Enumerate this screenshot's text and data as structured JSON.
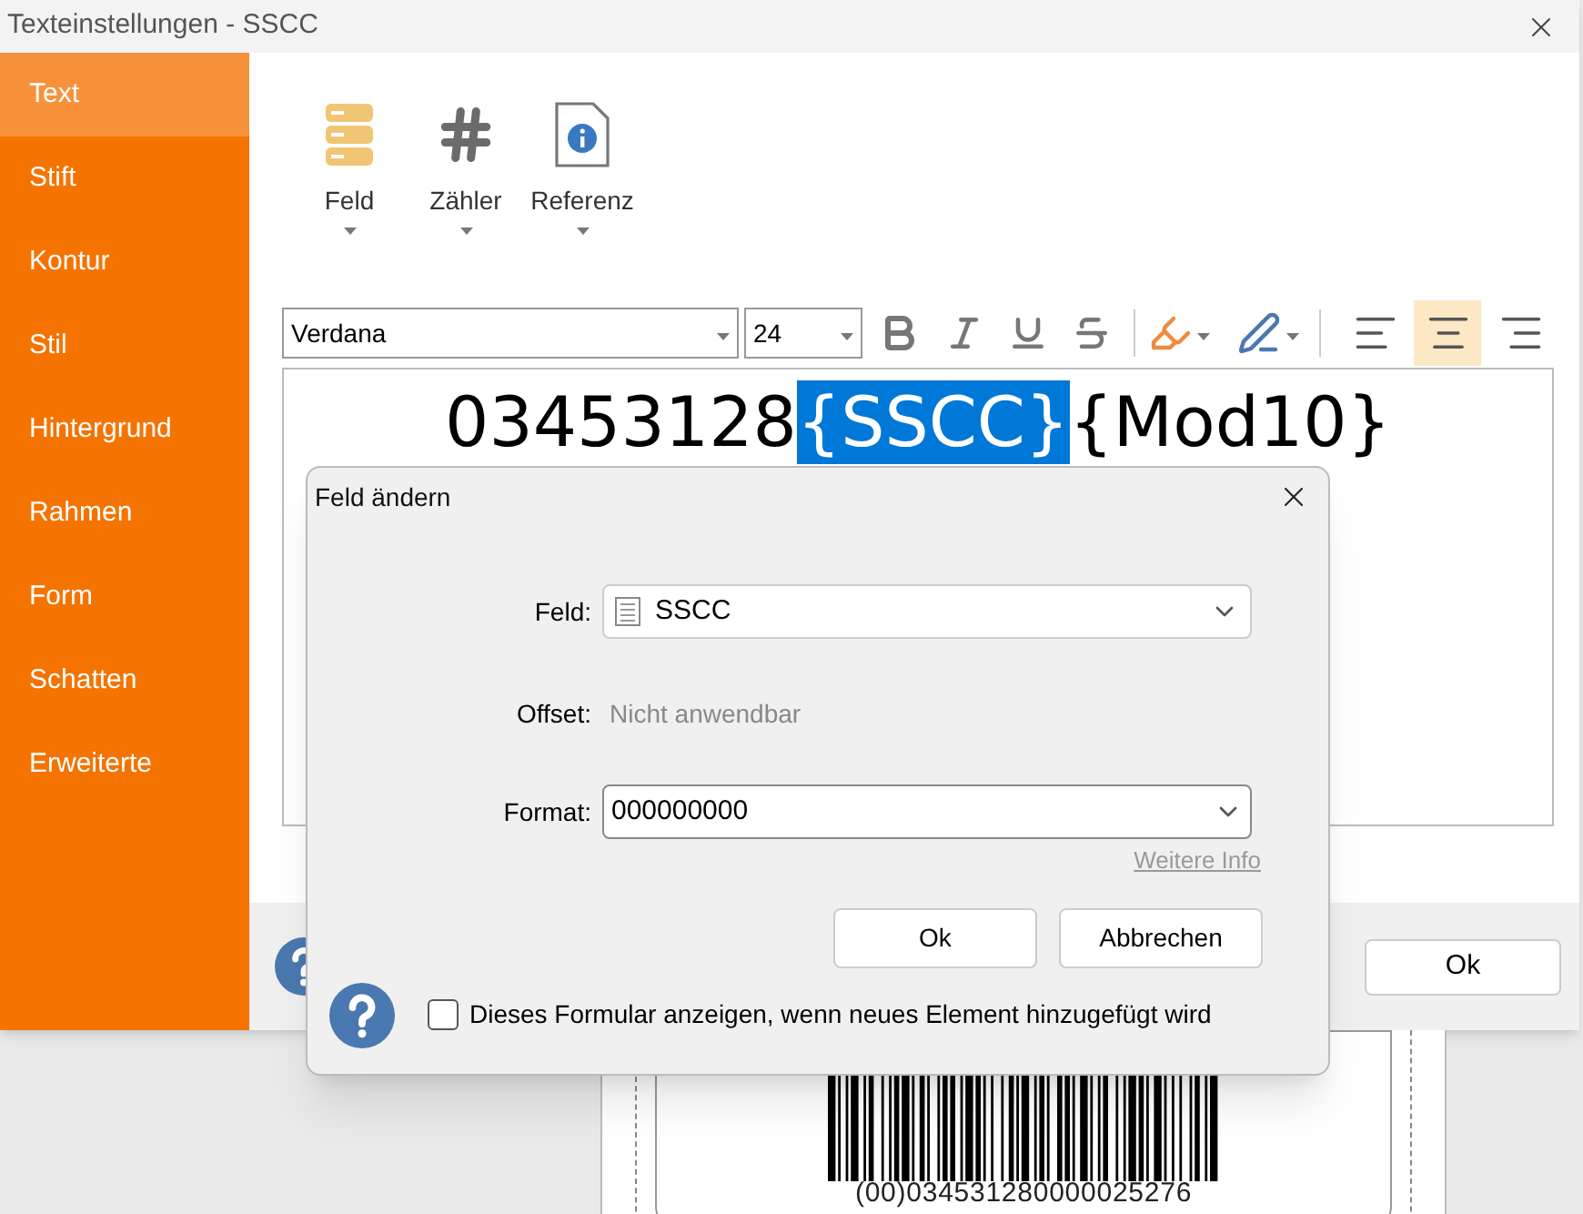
{
  "window": {
    "title": "Texteinstellungen - SSCC"
  },
  "sidebar": {
    "items": [
      {
        "label": "Text",
        "selected": true
      },
      {
        "label": "Stift",
        "selected": false
      },
      {
        "label": "Kontur",
        "selected": false
      },
      {
        "label": "Stil",
        "selected": false
      },
      {
        "label": "Hintergrund",
        "selected": false
      },
      {
        "label": "Rahmen",
        "selected": false
      },
      {
        "label": "Form",
        "selected": false
      },
      {
        "label": "Schatten",
        "selected": false
      },
      {
        "label": "Erweiterte",
        "selected": false
      }
    ]
  },
  "insert_toolbar": [
    {
      "kind": "field",
      "label": "Feld"
    },
    {
      "kind": "counter",
      "label": "Zähler"
    },
    {
      "kind": "reference",
      "label": "Referenz"
    }
  ],
  "format_toolbar": {
    "font": "Verdana",
    "size": "24",
    "alignments": [
      {
        "kind": "left",
        "selected": false
      },
      {
        "kind": "center",
        "selected": true
      },
      {
        "kind": "right",
        "selected": false
      }
    ]
  },
  "editor": {
    "segments": [
      {
        "text": "03453128",
        "selected": false
      },
      {
        "text": "{SSCC}",
        "selected": true
      },
      {
        "text": "{Mod10}",
        "selected": false
      }
    ]
  },
  "footer": {
    "ok_button": "Ok"
  },
  "dialog": {
    "title": "Feld ändern",
    "field_label": "Feld:",
    "field_value": "SSCC",
    "offset_label": "Offset:",
    "offset_value": "Nicht anwendbar",
    "format_label": "Format:",
    "format_value": "000000000",
    "more_info_link": "Weitere Info",
    "ok_button": "Ok",
    "cancel_button": "Abbrechen",
    "show_form_checkbox": {
      "label": "Dieses Formular anzeigen, wenn neues Element hinzugefügt wird",
      "checked": false
    }
  },
  "label_preview": {
    "barcode_text": "(00)034531280000025276"
  }
}
